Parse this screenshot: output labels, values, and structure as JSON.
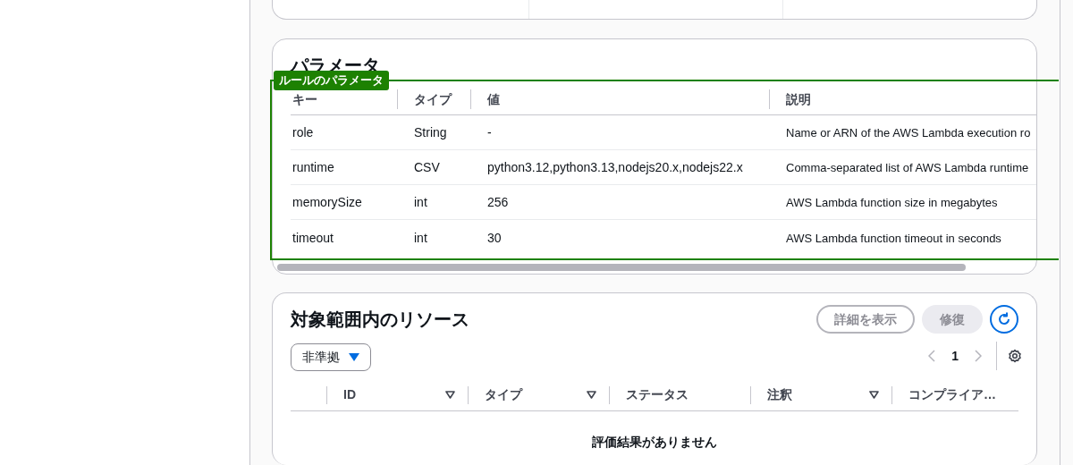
{
  "parameters": {
    "title": "パラメータ",
    "highlight_label": "ルールのパラメータ",
    "columns": [
      "キー",
      "タイプ",
      "値",
      "説明"
    ],
    "rows": [
      [
        "role",
        "String",
        "-",
        "Name or ARN of the AWS Lambda execution ro"
      ],
      [
        "runtime",
        "CSV",
        "python3.12,python3.13,nodejs20.x,nodejs22.x",
        "Comma-separated list of AWS Lambda runtime"
      ],
      [
        "memorySize",
        "int",
        "256",
        "AWS Lambda function size in megabytes"
      ],
      [
        "timeout",
        "int",
        "30",
        "AWS Lambda function timeout in seconds"
      ]
    ]
  },
  "resources": {
    "title": "対象範囲内のリソース",
    "buttons": [
      {
        "label": "詳細を表示",
        "kind": "normal",
        "disabled": true
      },
      {
        "label": "修復",
        "kind": "primary",
        "disabled": true
      }
    ],
    "filter": "非準拠",
    "page": "1",
    "columns": [
      {
        "label": "ID",
        "sortable": true
      },
      {
        "label": "タイプ",
        "sortable": true
      },
      {
        "label": "ステータス",
        "sortable": false
      },
      {
        "label": "注釈",
        "sortable": true
      },
      {
        "label": "コンプライア…",
        "sortable": false
      }
    ],
    "empty_message": "評価結果がありません"
  }
}
